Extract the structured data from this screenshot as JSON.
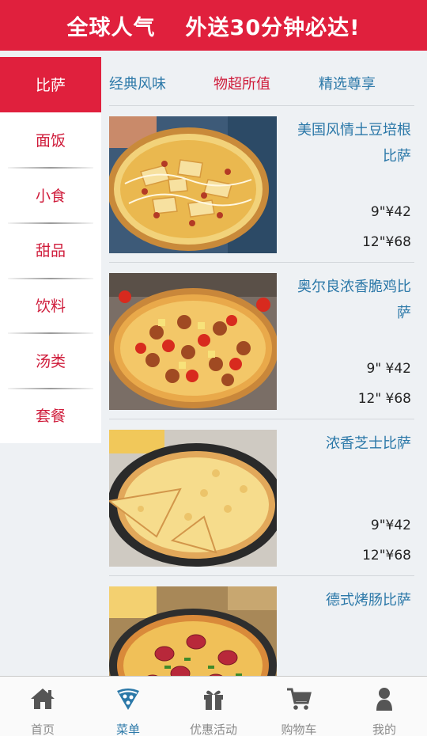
{
  "banner": {
    "left": "全球人气",
    "right": "外送30分钟必达!"
  },
  "sidebar": {
    "items": [
      {
        "label": "比萨",
        "active": true
      },
      {
        "label": "面饭"
      },
      {
        "label": "小食"
      },
      {
        "label": "甜品"
      },
      {
        "label": "饮料"
      },
      {
        "label": "汤类"
      },
      {
        "label": "套餐"
      }
    ]
  },
  "tabs": [
    {
      "label": "经典风味"
    },
    {
      "label": "物超所值",
      "active": true
    },
    {
      "label": "精选尊享"
    }
  ],
  "products": [
    {
      "name": "美国风情土豆培根比萨",
      "price9": "9\"¥42",
      "price12": "12\"¥68"
    },
    {
      "name": "奥尔良浓香脆鸡比萨",
      "price9": "9\" ¥42",
      "price12": "12\" ¥68"
    },
    {
      "name": "浓香芝士比萨",
      "price9": "9\"¥42",
      "price12": "12\"¥68"
    },
    {
      "name": "德式烤肠比萨",
      "price9": "",
      "price12": ""
    }
  ],
  "tabbar": {
    "items": [
      {
        "label": "首页",
        "icon": "home-icon"
      },
      {
        "label": "菜单",
        "icon": "pizza-slice-icon",
        "active": true
      },
      {
        "label": "优惠活动",
        "icon": "gift-icon"
      },
      {
        "label": "购物车",
        "icon": "cart-icon"
      },
      {
        "label": "我的",
        "icon": "user-icon"
      }
    ]
  },
  "colors": {
    "brand_red": "#e0203d",
    "link_blue": "#2b78a8",
    "text_dark": "#222222"
  }
}
